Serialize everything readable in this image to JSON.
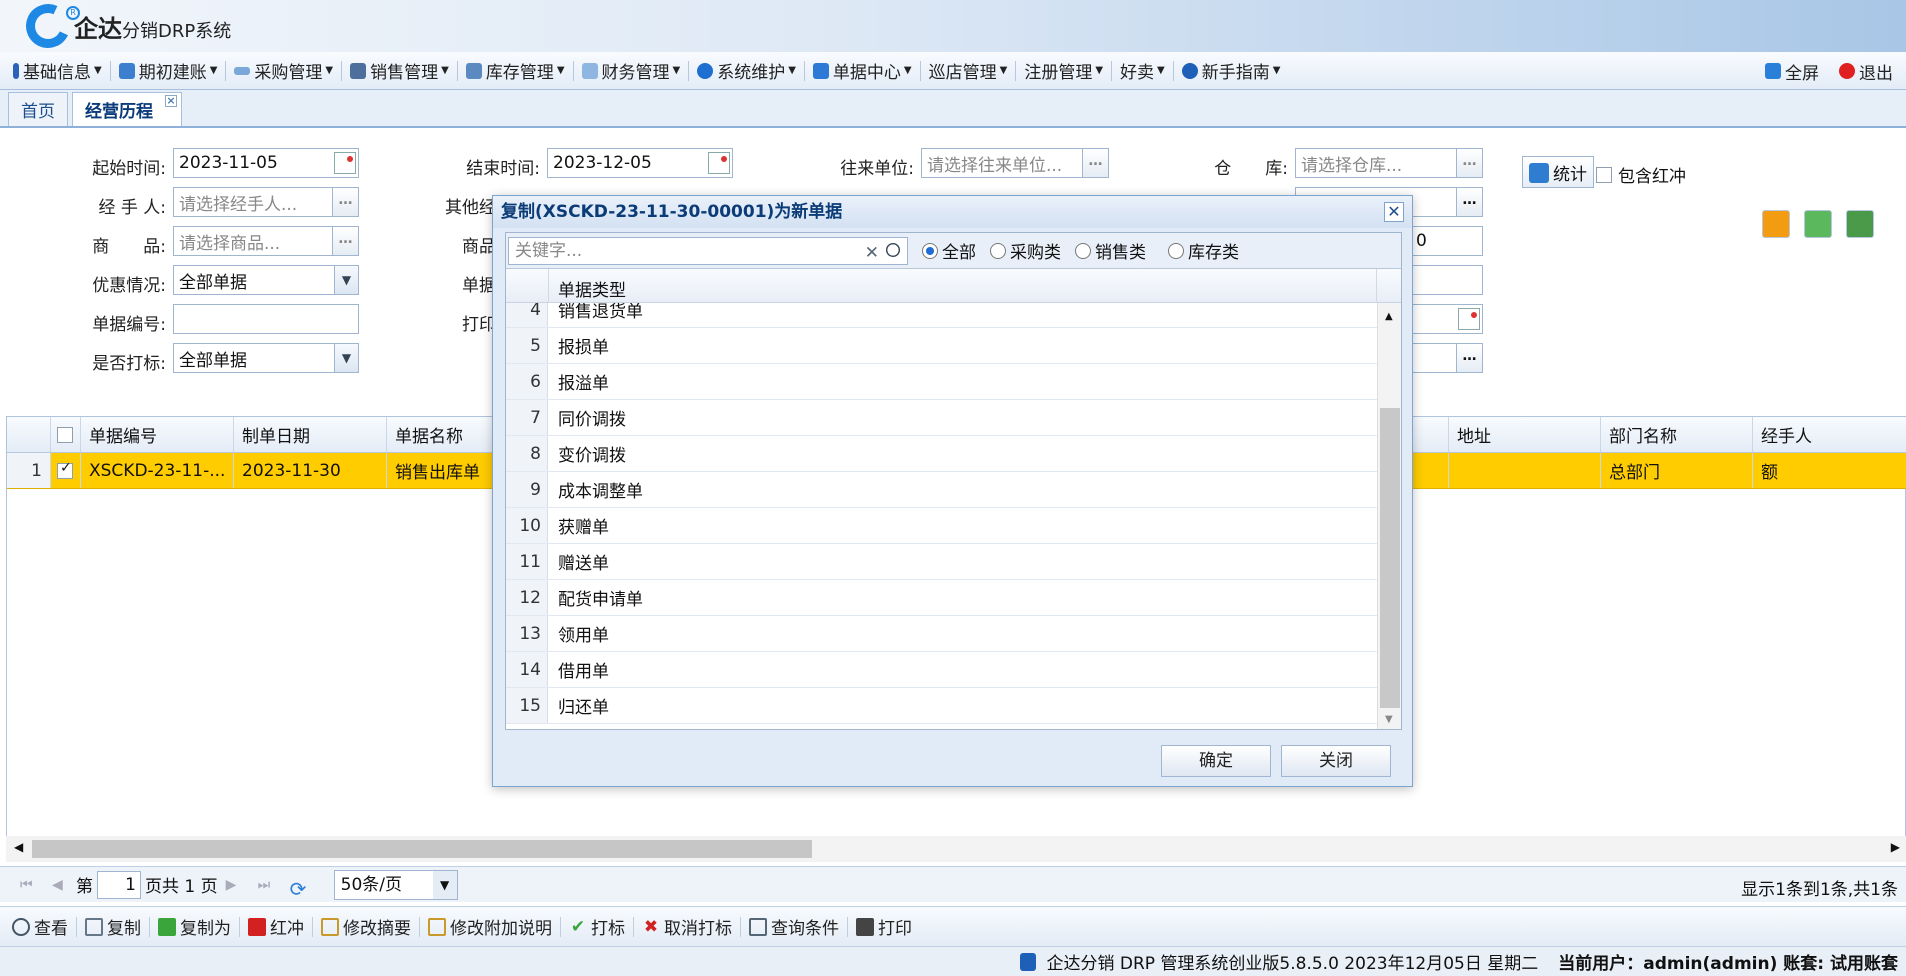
{
  "app": {
    "logo_main": "企达",
    "logo_sub": "分销DRP系统"
  },
  "menu": [
    {
      "label": "基础信息",
      "icon": "book-icon"
    },
    {
      "label": "期初建账",
      "icon": "ledger-icon"
    },
    {
      "label": "采购管理",
      "icon": "purchase-icon"
    },
    {
      "label": "销售管理",
      "icon": "sales-icon"
    },
    {
      "label": "库存管理",
      "icon": "inventory-icon"
    },
    {
      "label": "财务管理",
      "icon": "finance-icon"
    },
    {
      "label": "系统维护",
      "icon": "system-icon"
    },
    {
      "label": "单据中心",
      "icon": "document-icon"
    },
    {
      "label": "巡店管理",
      "icon": ""
    },
    {
      "label": "注册管理",
      "icon": ""
    },
    {
      "label": "好卖",
      "icon": ""
    },
    {
      "label": "新手指南",
      "icon": "help-icon"
    }
  ],
  "menu_right": {
    "fullscreen": "全屏",
    "exit": "退出"
  },
  "tabs": [
    {
      "label": "首页"
    },
    {
      "label": "经营历程"
    }
  ],
  "filters": {
    "start_time_label": "起始时间:",
    "start_time": "2023-11-05",
    "end_time_label": "结束时间:",
    "end_time": "2023-12-05",
    "partner_label": "往来单位:",
    "partner_placeholder": "请选择往来单位...",
    "warehouse_label": "仓　　库:",
    "warehouse_placeholder": "请选择仓库...",
    "handler_label": "经 手 人:",
    "handler_placeholder": "请选择经手人...",
    "other_label": "其他经",
    "goods_label": "商　　品:",
    "goods_placeholder": "请选择商品...",
    "goods2_label": "商品",
    "discount_label": "优惠情况:",
    "discount_value": "全部单据",
    "doc_label": "单据",
    "docno_label": "单据编号:",
    "docno_value": "",
    "print_label": "打印",
    "marked_label": "是否打标:",
    "marked_value": "全部单据",
    "partial_value": "0",
    "stat_button": "统计",
    "include_red": "包含红冲"
  },
  "grid": {
    "headers": [
      "单据编号",
      "制单日期",
      "单据名称",
      "地址",
      "部门名称",
      "经手人"
    ],
    "rows": [
      {
        "num": "1",
        "doc_no": "XSCKD-23-11-...",
        "date": "2023-11-30",
        "name": "销售出库单",
        "address": "",
        "dept": "总部门",
        "handler": "额"
      }
    ]
  },
  "pager": {
    "page_prefix": "第",
    "page": "1",
    "page_suffix": "页共 1 页",
    "per_page": "50条/页",
    "info": "显示1条到1条,共1条"
  },
  "bottom_actions": [
    {
      "label": "查看",
      "icon": "view-icon"
    },
    {
      "label": "复制",
      "icon": "copy-icon"
    },
    {
      "label": "复制为",
      "icon": "copy-as-icon"
    },
    {
      "label": "红冲",
      "icon": "red-reverse-icon"
    },
    {
      "label": "修改摘要",
      "icon": "edit-summary-icon"
    },
    {
      "label": "修改附加说明",
      "icon": "edit-note-icon"
    },
    {
      "label": "打标",
      "icon": "check-icon"
    },
    {
      "label": "取消打标",
      "icon": "cancel-icon"
    },
    {
      "label": "查询条件",
      "icon": "query-icon"
    },
    {
      "label": "打印",
      "icon": "print-icon"
    }
  ],
  "status": {
    "version": "企达分销 DRP 管理系统创业版5.8.5.0 2023年12月05日 星期二",
    "user": "当前用户：admin(admin) 账套: 试用账套"
  },
  "dialog": {
    "title": "复制(XSCKD-23-11-30-00001)为新单据",
    "keyword_placeholder": "关键字...",
    "filters": [
      "全部",
      "采购类",
      "销售类",
      "库存类"
    ],
    "column_header": "单据类型",
    "rows": [
      {
        "n": "4",
        "t": "销售退货单"
      },
      {
        "n": "5",
        "t": "报损单"
      },
      {
        "n": "6",
        "t": "报溢单"
      },
      {
        "n": "7",
        "t": "同价调拨"
      },
      {
        "n": "8",
        "t": "变价调拨"
      },
      {
        "n": "9",
        "t": "成本调整单"
      },
      {
        "n": "10",
        "t": "获赠单"
      },
      {
        "n": "11",
        "t": "赠送单"
      },
      {
        "n": "12",
        "t": "配货申请单"
      },
      {
        "n": "13",
        "t": "领用单"
      },
      {
        "n": "14",
        "t": "借用单"
      },
      {
        "n": "15",
        "t": "归还单"
      }
    ],
    "ok": "确定",
    "close": "关闭"
  },
  "colors": {
    "selected_row": "#ffcc00",
    "accent": "#1e6bd6"
  }
}
